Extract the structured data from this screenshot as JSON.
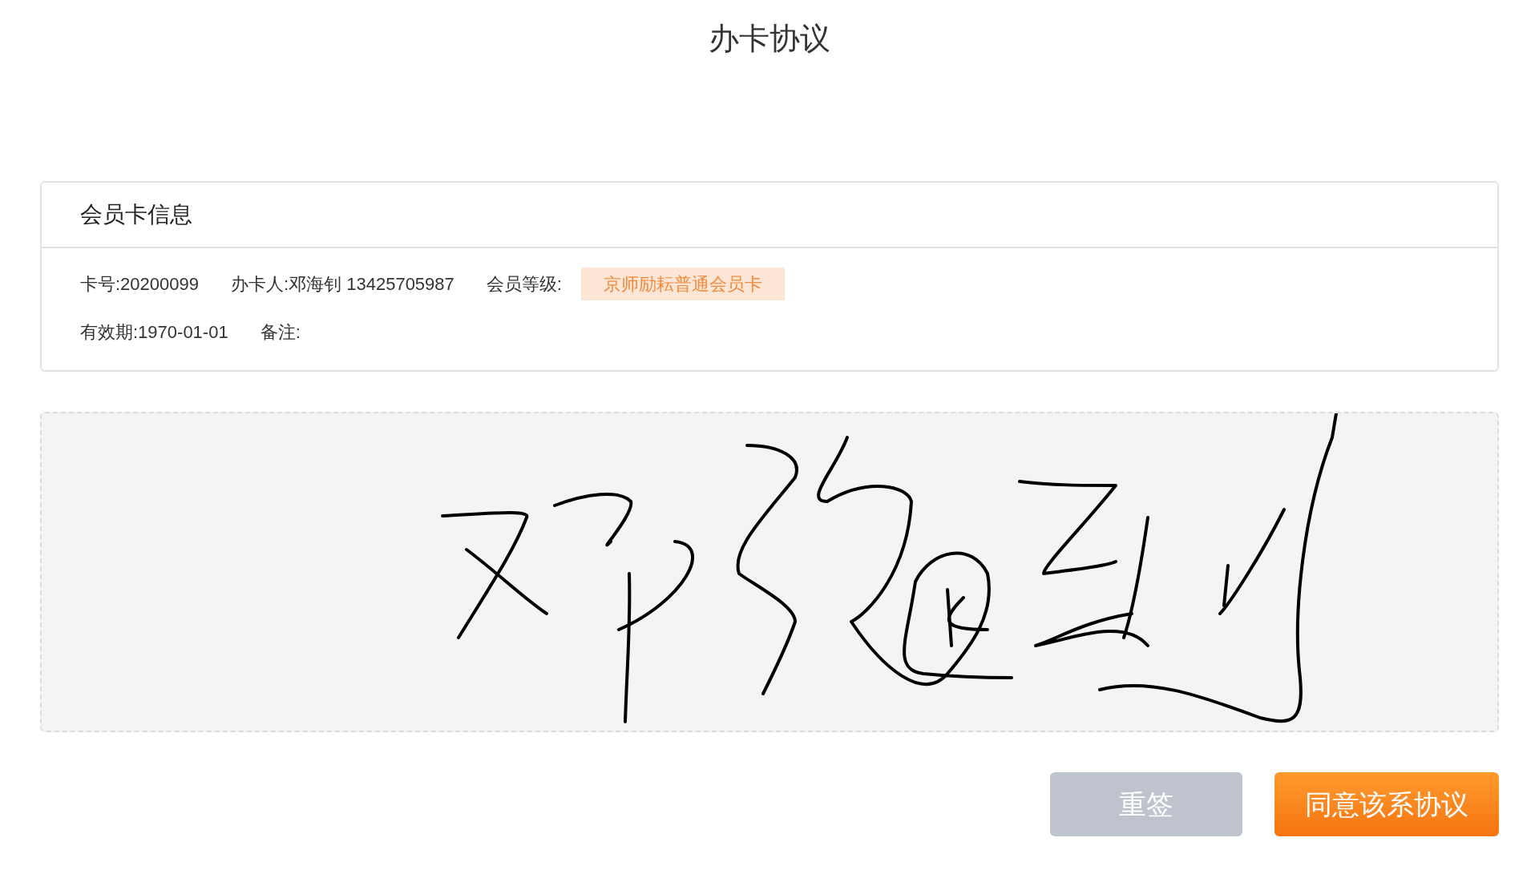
{
  "page": {
    "title": "办卡协议"
  },
  "card": {
    "title": "会员卡信息",
    "fields": [
      {
        "text": "卡号:20200099",
        "kind": "plain"
      },
      {
        "text": "办卡人:邓海钊 13425705987",
        "kind": "plain"
      },
      {
        "text": "会员等级:",
        "kind": "plain"
      },
      {
        "text": "京师励耘普通会员卡",
        "kind": "tag"
      },
      {
        "text": "有效期:1970-01-01",
        "kind": "plain"
      },
      {
        "text": "备注:",
        "kind": "plain"
      }
    ]
  },
  "buttons": [
    {
      "label": "重签",
      "kind": "secondary"
    },
    {
      "label": "同意该系协议",
      "kind": "primary"
    }
  ]
}
